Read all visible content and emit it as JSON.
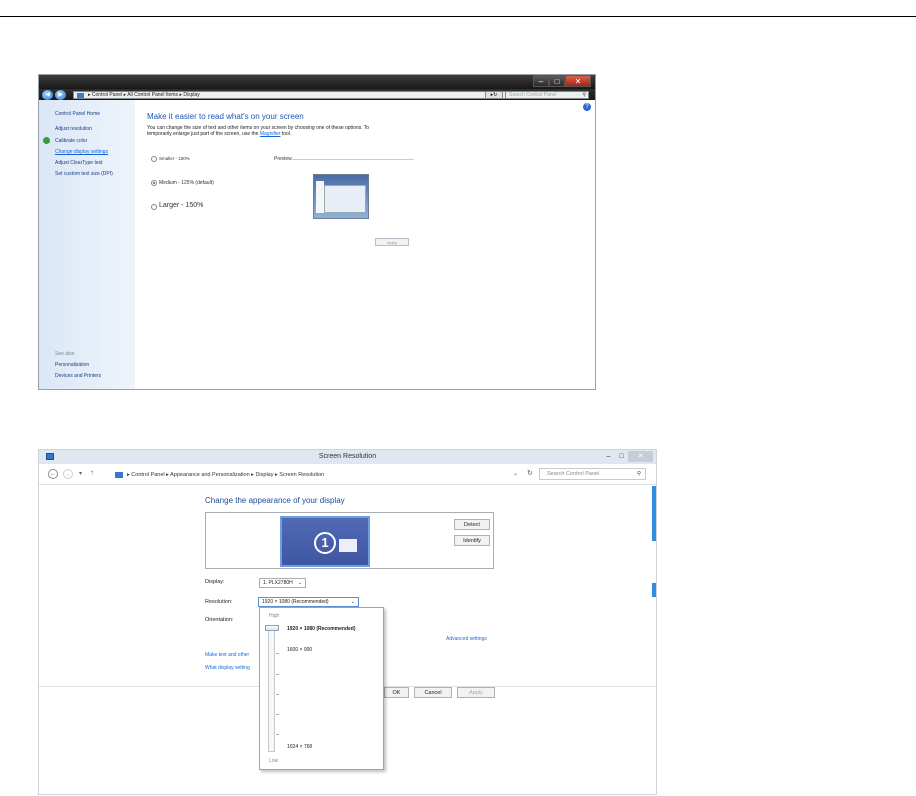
{
  "win7": {
    "nav": {
      "address": "▸ Control Panel ▸ All Control Panel Items ▸ Display",
      "search_placeholder": "Search Control Panel"
    },
    "sidebar": {
      "items": [
        "Control Panel Home",
        "Adjust resolution",
        "Calibrate color",
        "Change display settings",
        "Adjust ClearType text",
        "Set custom text size (DPI)"
      ],
      "see_also": "See also",
      "see_also_items": [
        "Personalization",
        "Devices and Printers"
      ]
    },
    "main": {
      "title": "Make it easier to read what's on your screen",
      "desc_line1": "You can change the size of text and other items on your screen by choosing one of these options. To",
      "desc_line2_pre": "temporarily enlarge just part of the screen, use the ",
      "desc_link": "Magnifier",
      "desc_line2_post": " tool.",
      "options": [
        {
          "label": "Smaller - 100%",
          "selected": false
        },
        {
          "label": "Medium - 125% (default)",
          "selected": true
        },
        {
          "label": "Larger - 150%",
          "selected": false
        }
      ],
      "preview_label": "Preview",
      "apply_label": "Apply"
    }
  },
  "win8": {
    "title": "Screen Resolution",
    "nav": {
      "breadcrumb": "▸ Control Panel ▸ Appearance and Personalization ▸ Display ▸ Screen Resolution",
      "search_placeholder": "Search Control Panel"
    },
    "heading": "Change the appearance of your display",
    "monitor_number": "1",
    "detect_label": "Detect",
    "identify_label": "Identify",
    "display_label": "Display:",
    "display_value": "1. PLX2780H",
    "resolution_label": "Resolution:",
    "resolution_value": "1920 × 1080 (Recommended)",
    "orientation_label": "Orientation:",
    "advanced_link": "Advanced settings",
    "link_text_size": "Make text and other",
    "link_what_display": "What display setting",
    "ok_label": "OK",
    "cancel_label": "Cancel",
    "apply_label": "Apply",
    "dropdown": {
      "high_label": "High",
      "options": [
        "1920 × 1080 (Recommended)",
        "1600 × 900",
        "1024 × 768"
      ],
      "low_label": "Low"
    }
  }
}
